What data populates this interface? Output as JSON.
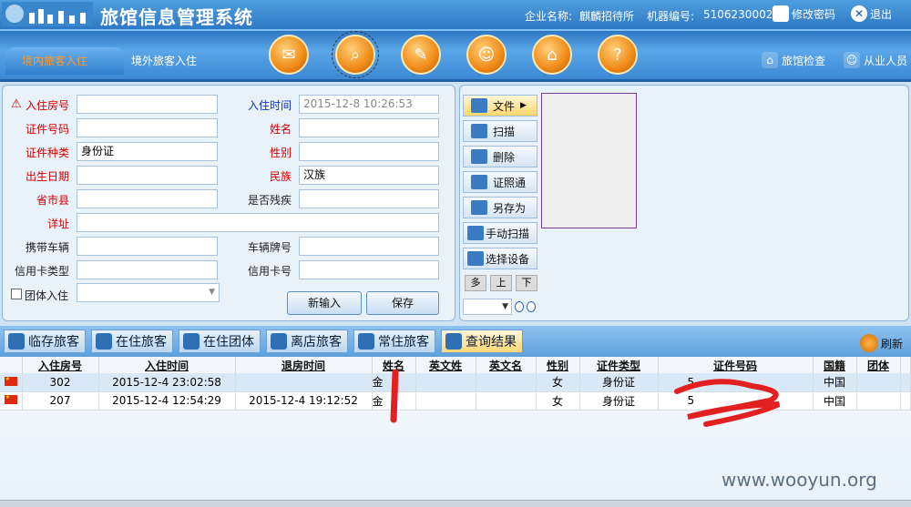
{
  "header": {
    "title": "旅馆信息管理系统",
    "company_label": "企业名称:",
    "company_value": "麒麟招待所",
    "machine_label": "机器编号:",
    "machine_value": "5106230002",
    "change_password": "修改密码",
    "exit": "退出"
  },
  "toolbar": {
    "tabs": [
      "境内旅客入住",
      "境外旅客入住"
    ],
    "hotel_check": "旅馆检查",
    "staff": "从业人员"
  },
  "form": {
    "room_label": "入住房号",
    "checkin_time_label": "入住时间",
    "checkin_time_value": "2015-12-8 10:26:53",
    "id_number_label": "证件号码",
    "name_label": "姓名",
    "id_type_label": "证件种类",
    "id_type_value": "身份证",
    "gender_label": "性别",
    "birth_label": "出生日期",
    "ethnicity_label": "民族",
    "ethnicity_value": "汉族",
    "province_label": "省市县",
    "disabled_label": "是否残疾",
    "address_label": "详址",
    "vehicle_label": "携带车辆",
    "plate_label": "车辆牌号",
    "card_type_label": "信用卡类型",
    "card_no_label": "信用卡号",
    "group_label": "团体入住",
    "new_button": "新输入",
    "save_button": "保存"
  },
  "side": {
    "file": "文件",
    "scan": "扫描",
    "delete": "删除",
    "idphoto": "证照通",
    "save_as": "另存为",
    "manual_scan": "手动扫描",
    "select_device": "选择设备",
    "multi": "多",
    "up": "上",
    "down": "下"
  },
  "bottom_tabs": [
    "临存旅客",
    "在住旅客",
    "在住团体",
    "离店旅客",
    "常住旅客",
    "查询结果"
  ],
  "refresh": "刷新",
  "table": {
    "headers": [
      "入住房号",
      "入住时间",
      "退房时间",
      "姓名",
      "英文姓",
      "英文名",
      "性别",
      "证件类型",
      "证件号码",
      "国籍",
      "团体"
    ],
    "rows": [
      {
        "room": "302",
        "checkin": "2015-12-4 23:02:58",
        "checkout": "",
        "name": "金",
        "en_last": "",
        "en_first": "",
        "gender": "女",
        "id_type": "身份证",
        "id_no": "5",
        "nationality": "中国",
        "group": ""
      },
      {
        "room": "207",
        "checkin": "2015-12-4 12:54:29",
        "checkout": "2015-12-4 19:12:52",
        "name": "金",
        "en_last": "",
        "en_first": "",
        "gender": "女",
        "id_type": "身份证",
        "id_no": "5",
        "nationality": "中国",
        "group": ""
      }
    ]
  },
  "watermark": "www.wooyun.org"
}
